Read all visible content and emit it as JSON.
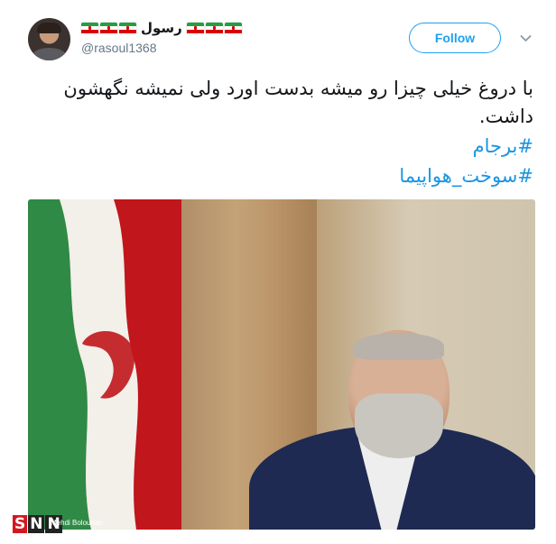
{
  "tweet": {
    "display_name": "رسول",
    "handle": "@rasoul1368",
    "follow_label": "Follow",
    "text": "با دروغ خیلی چیزا رو میشه بدست اورد ولی نمیشه نگهشون داشت.",
    "hashtags": [
      "#برجام",
      "#سوخت_هواپیما"
    ]
  },
  "media": {
    "credit": "Mehdi Bolourian",
    "watermark": "SNN"
  },
  "colors": {
    "accent": "#1da1f2",
    "hashtag": "#1b95e0",
    "handle": "#657786",
    "text": "#14171a"
  },
  "icons": {
    "flag": "iran-flag-emoji",
    "menu": "chevron-down-icon"
  }
}
